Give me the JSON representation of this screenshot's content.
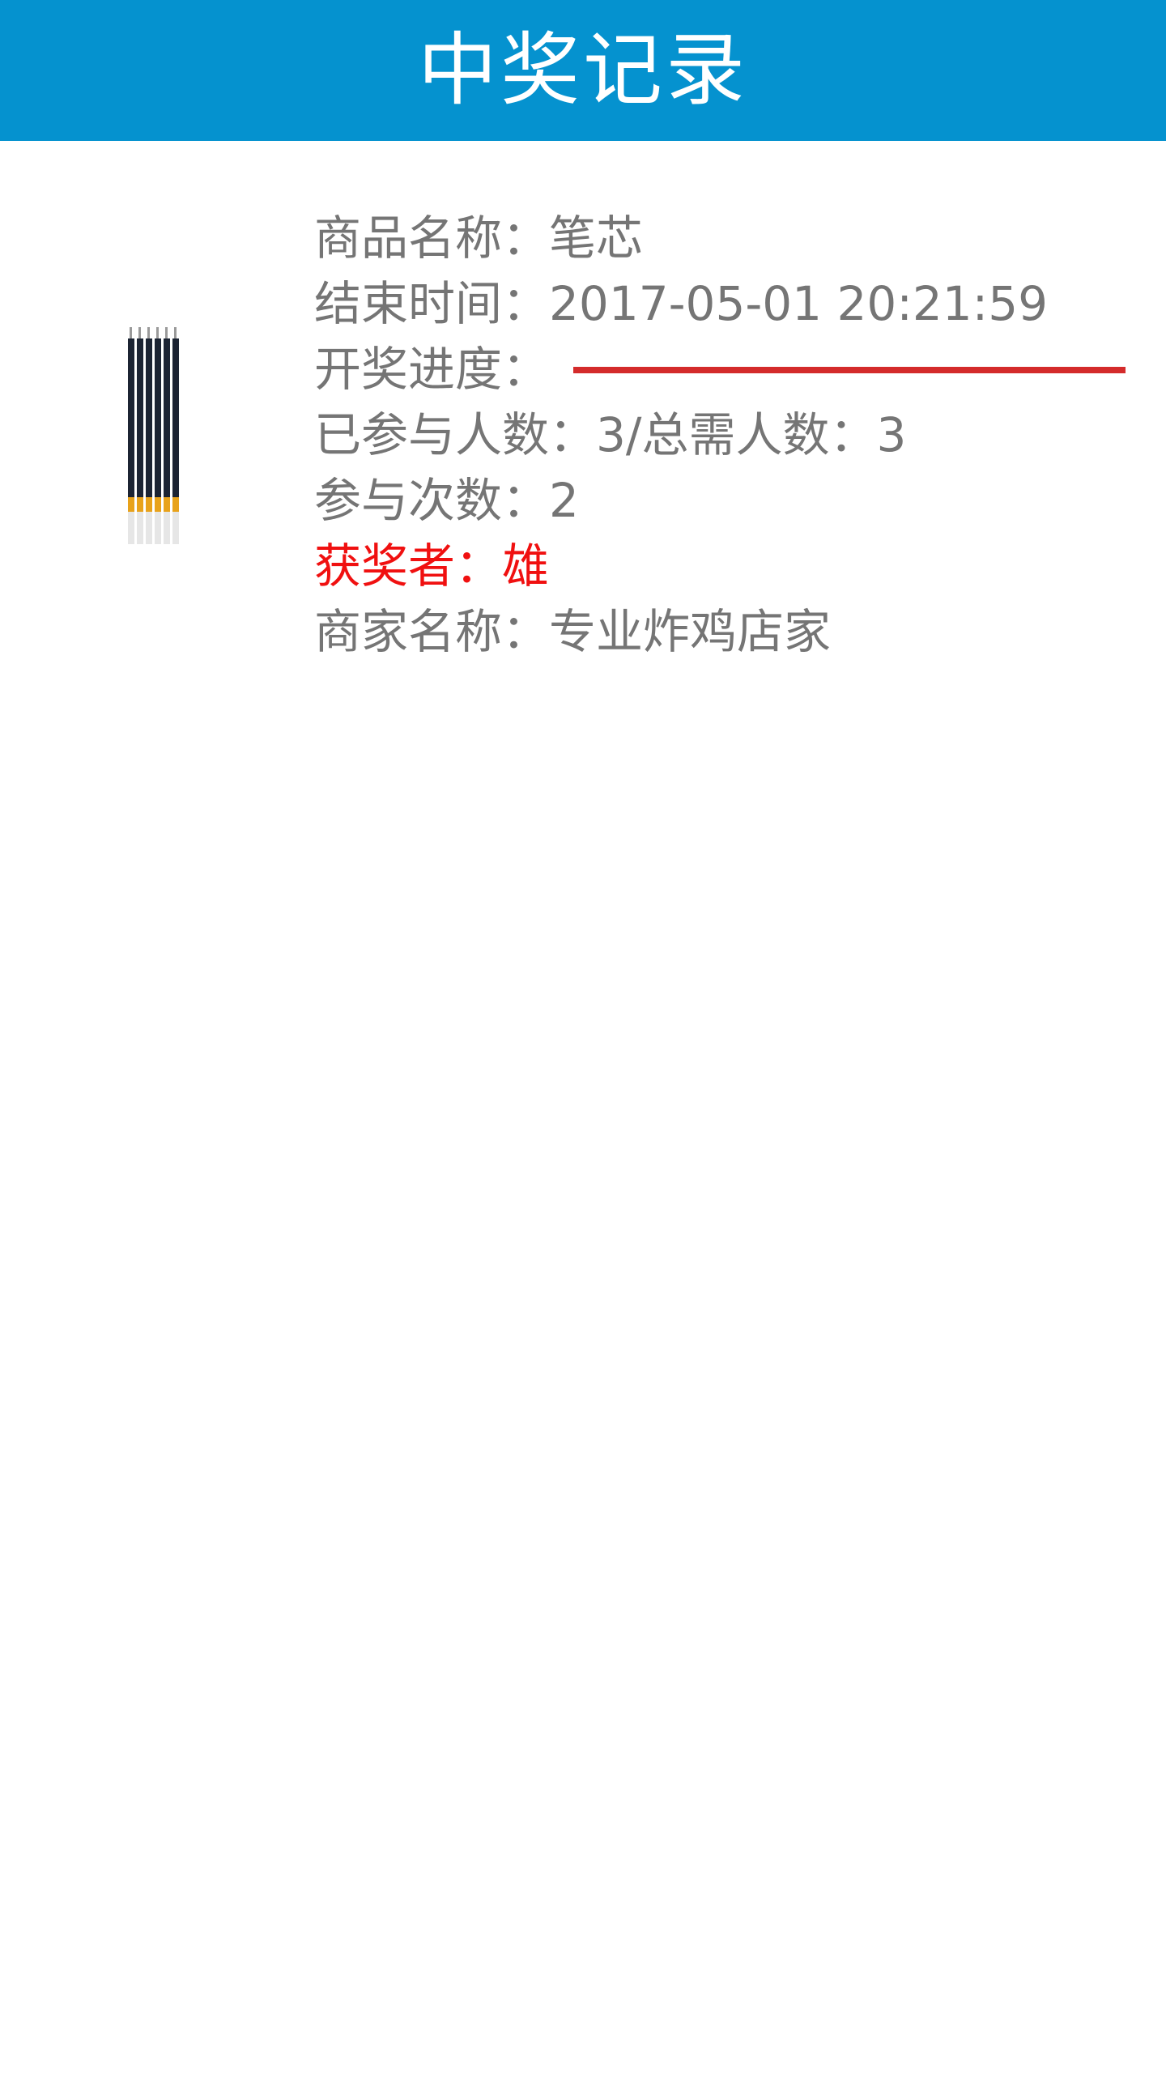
{
  "header": {
    "title": "中奖记录",
    "background_color": "#0592cf"
  },
  "record": {
    "product": {
      "label": "商品名称：",
      "value": "笔芯"
    },
    "end_time": {
      "label": "结束时间：",
      "value": "2017-05-01 20:21:59"
    },
    "progress": {
      "label": "开奖进度：",
      "fraction": 1.0,
      "fill_color": "#d42b2b"
    },
    "participants": {
      "text": "已参与人数：3/总需人数：3"
    },
    "times": {
      "label": "参与次数：",
      "value": "2"
    },
    "winner": {
      "label": "获奖者：",
      "value": "雄",
      "color": "#f01010"
    },
    "merchant": {
      "label": "商家名称：",
      "value": "专业炸鸡店家"
    },
    "image_icon": "pen-refills-image"
  }
}
